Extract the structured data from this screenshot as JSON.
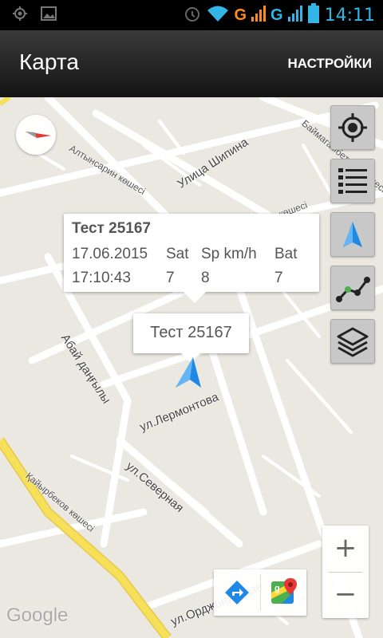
{
  "status_bar": {
    "time": "14:11",
    "network_1": "G",
    "network_2": "G",
    "icons": [
      "location-icon",
      "image-icon",
      "alarm-icon",
      "wifi-icon",
      "signal-icon",
      "battery-icon"
    ]
  },
  "app_bar": {
    "title": "Карта",
    "settings_label": "НАСТРОЙКИ"
  },
  "map": {
    "streets": [
      "Алтынсарин көшесі",
      "Улица Шипина",
      "Баймагамбетова көшесі",
      "көшесі",
      "Абай даңғылы",
      "ул.Лермонтова",
      "ул.Северная",
      "Қайырбеков көшесі",
      "ул.Орджоникидзе"
    ],
    "info_window": {
      "title": "Тест 25167",
      "date": "17.06.2015",
      "time": "17:10:43",
      "col_sat": "Sat",
      "col_speed": "Sp km/h",
      "col_bat": "Bat",
      "sat_value": "7",
      "speed_value": "8",
      "bat_value": "7"
    },
    "marker_label": "Тест 25167",
    "zoom_in": "+",
    "zoom_out": "−",
    "attribution": "Google"
  },
  "side_buttons": [
    "my-location",
    "list",
    "navigation",
    "track",
    "layers"
  ],
  "colors": {
    "accent": "#33b5e5",
    "network": "#ff8c1a",
    "map_bg": "#ebe8e1",
    "marker": "#1e88e5",
    "highway": "#f6df59"
  }
}
